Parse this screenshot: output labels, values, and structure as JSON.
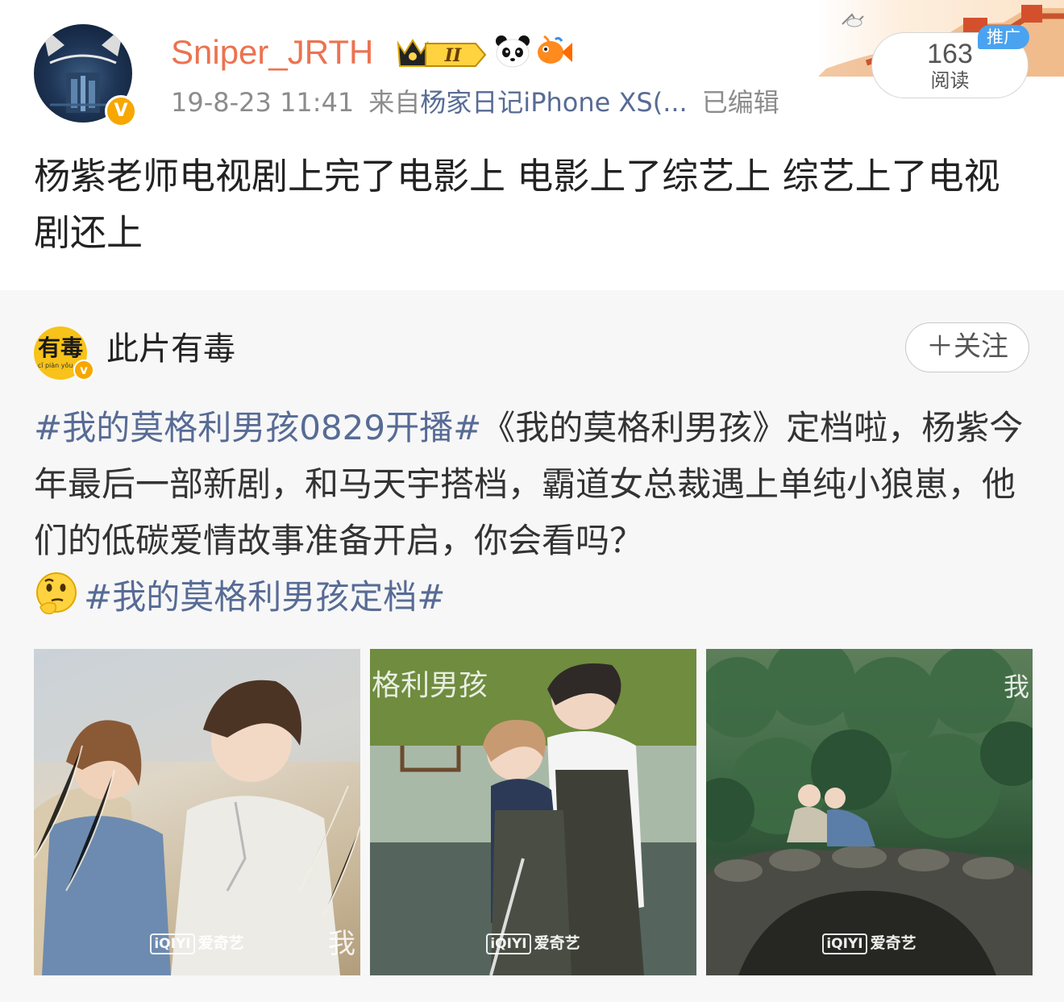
{
  "post": {
    "username": "Sniper_JRTH",
    "vip_level": "II",
    "timestamp": "19-8-23 11:41",
    "source_prefix": "来自",
    "source_name": "杨家日记iPhone XS(...",
    "edited_label": "已编辑",
    "read_count": "163",
    "read_label": "阅读",
    "promo_tag": "推广",
    "verified_mark": "V",
    "text": "杨紫老师电视剧上完了电影上 电影上了综艺上 综艺上了电视剧还上"
  },
  "repost": {
    "author_name": "此片有毒",
    "author_logo_text": "有毒",
    "author_logo_sub": "cǐ piàn yǒu dú",
    "verified_mark": "v",
    "follow_label": "＋关注",
    "hashtag_1": "#我的莫格利男孩0829开播#",
    "text_main": "《我的莫格利男孩》定档啦，杨紫今年最后一部新剧，和马天宇搭档，霸道女总裁遇上单纯小狼崽，他们的低碳爱情故事准备开启，你会看吗？",
    "hashtag_2": "#我的莫格利男孩定档#",
    "emoji_name": "thinking-emoji",
    "photos": [
      {
        "watermark_logo": "iQIYI",
        "watermark_text": "爱奇艺",
        "title_fragment": "我"
      },
      {
        "watermark_logo": "iQIYI",
        "watermark_text": "爱奇艺",
        "title_fragment": "格利男孩"
      },
      {
        "watermark_logo": "iQIYI",
        "watermark_text": "爱奇艺",
        "title_fragment": "我"
      }
    ]
  },
  "colors": {
    "username": "#eb7350",
    "link": "#576b95",
    "meta": "#8c8c8c",
    "promo": "#4aa3f0",
    "verified": "#f7a700",
    "repost_bg": "#f7f7f7"
  }
}
